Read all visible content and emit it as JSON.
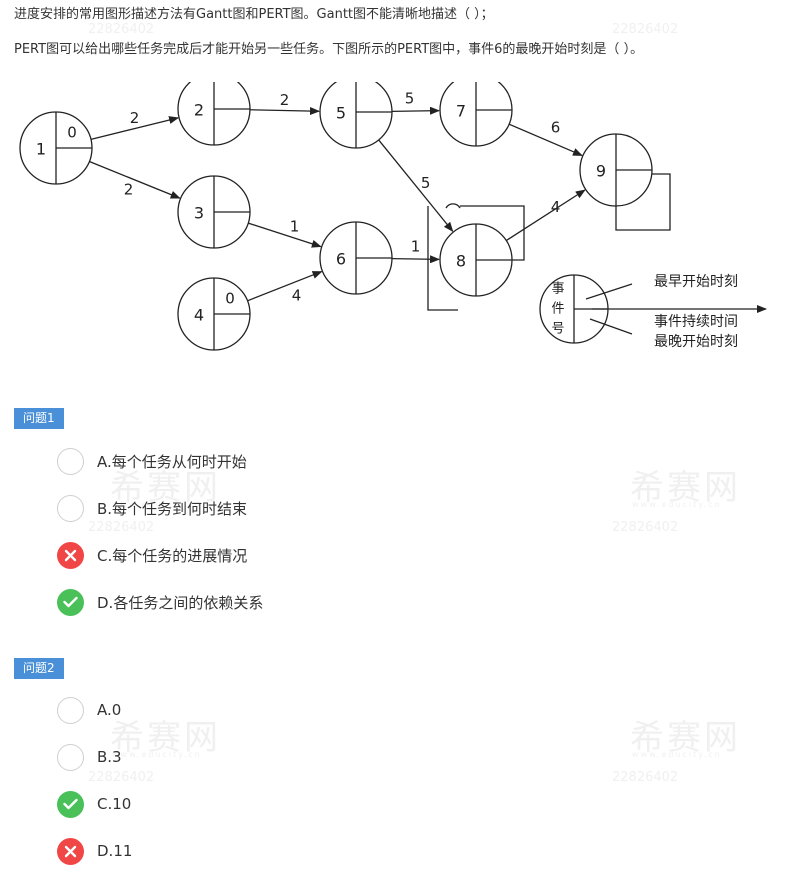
{
  "question": {
    "line1": "进度安排的常用图形描述方法有Gantt图和PERT图。Gantt图不能清晰地描述（ ）；",
    "line2": "PERT图可以给出哪些任务完成后才能开始另一些任务。下图所示的PERT图中，事件6的最晚开始时刻是（ ）。"
  },
  "diagram": {
    "nodes": [
      {
        "id": "1",
        "side": "0"
      },
      {
        "id": "2",
        "side": ""
      },
      {
        "id": "3",
        "side": ""
      },
      {
        "id": "4",
        "side": "0"
      },
      {
        "id": "5",
        "side": ""
      },
      {
        "id": "6",
        "side": ""
      },
      {
        "id": "7",
        "side": ""
      },
      {
        "id": "8",
        "side": ""
      },
      {
        "id": "9",
        "side": ""
      }
    ],
    "edges": [
      {
        "from": "1",
        "to": "2",
        "weight": "2"
      },
      {
        "from": "1",
        "to": "3",
        "weight": "2"
      },
      {
        "from": "2",
        "to": "5",
        "weight": "2"
      },
      {
        "from": "3",
        "to": "6",
        "weight": "1"
      },
      {
        "from": "4",
        "to": "6",
        "weight": "4"
      },
      {
        "from": "5",
        "to": "7",
        "weight": "5"
      },
      {
        "from": "5",
        "to": "8",
        "weight": "5"
      },
      {
        "from": "6",
        "to": "8",
        "weight": "1"
      },
      {
        "from": "7",
        "to": "9",
        "weight": "6"
      },
      {
        "from": "8",
        "to": "9",
        "weight": "4"
      }
    ],
    "legend": {
      "event_label_lines": [
        "事",
        "件",
        "号"
      ],
      "earliest_start": "最早开始时刻",
      "duration": "事件持续时间",
      "latest_start": "最晚开始时刻"
    }
  },
  "questions": [
    {
      "label": "问题1",
      "options": [
        {
          "text": "A.每个任务从何时开始",
          "state": "empty"
        },
        {
          "text": "B.每个任务到何时结束",
          "state": "empty"
        },
        {
          "text": "C.每个任务的进展情况",
          "state": "wrong"
        },
        {
          "text": "D.各任务之间的依赖关系",
          "state": "right"
        }
      ]
    },
    {
      "label": "问题2",
      "options": [
        {
          "text": "A.0",
          "state": "empty"
        },
        {
          "text": "B.3",
          "state": "empty"
        },
        {
          "text": "C.10",
          "state": "right"
        },
        {
          "text": "D.11",
          "state": "wrong"
        }
      ]
    }
  ],
  "watermark": {
    "logo": "希赛网",
    "sub": "www.educity.cn",
    "number": "22826402"
  },
  "colors": {
    "badge": "#4a90d9",
    "correct": "#49c158",
    "wrong": "#f04646",
    "empty_border": "#cfcfcf"
  }
}
